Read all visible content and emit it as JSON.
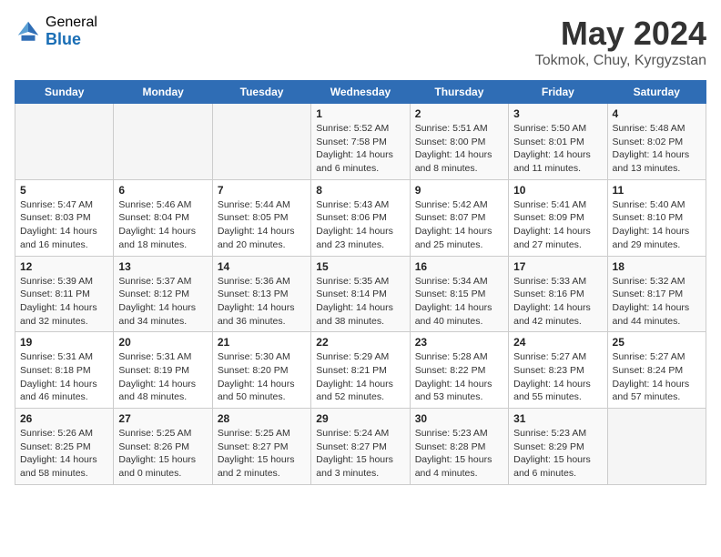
{
  "header": {
    "logo_general": "General",
    "logo_blue": "Blue",
    "month": "May 2024",
    "location": "Tokmok, Chuy, Kyrgyzstan"
  },
  "weekdays": [
    "Sunday",
    "Monday",
    "Tuesday",
    "Wednesday",
    "Thursday",
    "Friday",
    "Saturday"
  ],
  "weeks": [
    [
      {
        "day": "",
        "info": ""
      },
      {
        "day": "",
        "info": ""
      },
      {
        "day": "",
        "info": ""
      },
      {
        "day": "1",
        "info": "Sunrise: 5:52 AM\nSunset: 7:58 PM\nDaylight: 14 hours\nand 6 minutes."
      },
      {
        "day": "2",
        "info": "Sunrise: 5:51 AM\nSunset: 8:00 PM\nDaylight: 14 hours\nand 8 minutes."
      },
      {
        "day": "3",
        "info": "Sunrise: 5:50 AM\nSunset: 8:01 PM\nDaylight: 14 hours\nand 11 minutes."
      },
      {
        "day": "4",
        "info": "Sunrise: 5:48 AM\nSunset: 8:02 PM\nDaylight: 14 hours\nand 13 minutes."
      }
    ],
    [
      {
        "day": "5",
        "info": "Sunrise: 5:47 AM\nSunset: 8:03 PM\nDaylight: 14 hours\nand 16 minutes."
      },
      {
        "day": "6",
        "info": "Sunrise: 5:46 AM\nSunset: 8:04 PM\nDaylight: 14 hours\nand 18 minutes."
      },
      {
        "day": "7",
        "info": "Sunrise: 5:44 AM\nSunset: 8:05 PM\nDaylight: 14 hours\nand 20 minutes."
      },
      {
        "day": "8",
        "info": "Sunrise: 5:43 AM\nSunset: 8:06 PM\nDaylight: 14 hours\nand 23 minutes."
      },
      {
        "day": "9",
        "info": "Sunrise: 5:42 AM\nSunset: 8:07 PM\nDaylight: 14 hours\nand 25 minutes."
      },
      {
        "day": "10",
        "info": "Sunrise: 5:41 AM\nSunset: 8:09 PM\nDaylight: 14 hours\nand 27 minutes."
      },
      {
        "day": "11",
        "info": "Sunrise: 5:40 AM\nSunset: 8:10 PM\nDaylight: 14 hours\nand 29 minutes."
      }
    ],
    [
      {
        "day": "12",
        "info": "Sunrise: 5:39 AM\nSunset: 8:11 PM\nDaylight: 14 hours\nand 32 minutes."
      },
      {
        "day": "13",
        "info": "Sunrise: 5:37 AM\nSunset: 8:12 PM\nDaylight: 14 hours\nand 34 minutes."
      },
      {
        "day": "14",
        "info": "Sunrise: 5:36 AM\nSunset: 8:13 PM\nDaylight: 14 hours\nand 36 minutes."
      },
      {
        "day": "15",
        "info": "Sunrise: 5:35 AM\nSunset: 8:14 PM\nDaylight: 14 hours\nand 38 minutes."
      },
      {
        "day": "16",
        "info": "Sunrise: 5:34 AM\nSunset: 8:15 PM\nDaylight: 14 hours\nand 40 minutes."
      },
      {
        "day": "17",
        "info": "Sunrise: 5:33 AM\nSunset: 8:16 PM\nDaylight: 14 hours\nand 42 minutes."
      },
      {
        "day": "18",
        "info": "Sunrise: 5:32 AM\nSunset: 8:17 PM\nDaylight: 14 hours\nand 44 minutes."
      }
    ],
    [
      {
        "day": "19",
        "info": "Sunrise: 5:31 AM\nSunset: 8:18 PM\nDaylight: 14 hours\nand 46 minutes."
      },
      {
        "day": "20",
        "info": "Sunrise: 5:31 AM\nSunset: 8:19 PM\nDaylight: 14 hours\nand 48 minutes."
      },
      {
        "day": "21",
        "info": "Sunrise: 5:30 AM\nSunset: 8:20 PM\nDaylight: 14 hours\nand 50 minutes."
      },
      {
        "day": "22",
        "info": "Sunrise: 5:29 AM\nSunset: 8:21 PM\nDaylight: 14 hours\nand 52 minutes."
      },
      {
        "day": "23",
        "info": "Sunrise: 5:28 AM\nSunset: 8:22 PM\nDaylight: 14 hours\nand 53 minutes."
      },
      {
        "day": "24",
        "info": "Sunrise: 5:27 AM\nSunset: 8:23 PM\nDaylight: 14 hours\nand 55 minutes."
      },
      {
        "day": "25",
        "info": "Sunrise: 5:27 AM\nSunset: 8:24 PM\nDaylight: 14 hours\nand 57 minutes."
      }
    ],
    [
      {
        "day": "26",
        "info": "Sunrise: 5:26 AM\nSunset: 8:25 PM\nDaylight: 14 hours\nand 58 minutes."
      },
      {
        "day": "27",
        "info": "Sunrise: 5:25 AM\nSunset: 8:26 PM\nDaylight: 15 hours\nand 0 minutes."
      },
      {
        "day": "28",
        "info": "Sunrise: 5:25 AM\nSunset: 8:27 PM\nDaylight: 15 hours\nand 2 minutes."
      },
      {
        "day": "29",
        "info": "Sunrise: 5:24 AM\nSunset: 8:27 PM\nDaylight: 15 hours\nand 3 minutes."
      },
      {
        "day": "30",
        "info": "Sunrise: 5:23 AM\nSunset: 8:28 PM\nDaylight: 15 hours\nand 4 minutes."
      },
      {
        "day": "31",
        "info": "Sunrise: 5:23 AM\nSunset: 8:29 PM\nDaylight: 15 hours\nand 6 minutes."
      },
      {
        "day": "",
        "info": ""
      }
    ]
  ]
}
